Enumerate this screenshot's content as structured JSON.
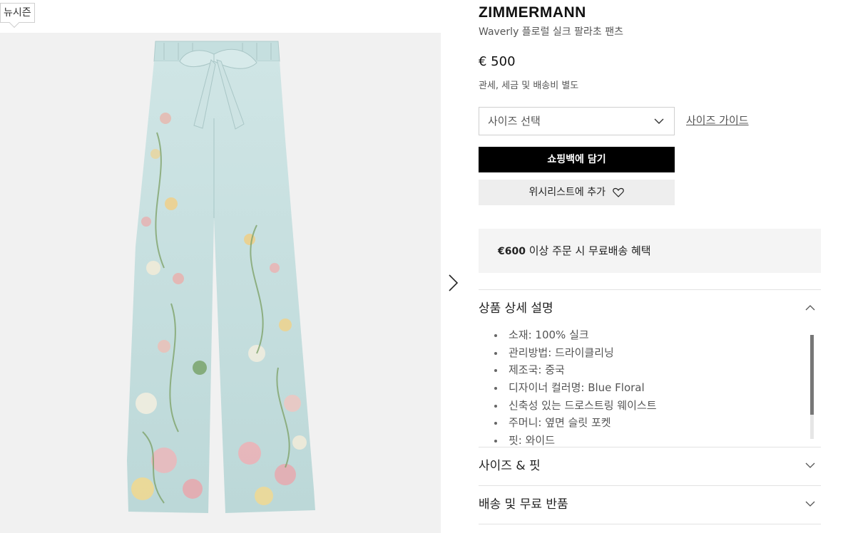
{
  "badge": {
    "label": "뉴시즌"
  },
  "product": {
    "brand": "ZIMMERMANN",
    "name": "Waverly 플로럴 실크 팔라초 팬츠",
    "price": "€ 500",
    "tax_note": "관세, 세금 및 배송비 별도"
  },
  "actions": {
    "size_select_placeholder": "사이즈 선택",
    "size_guide": "사이즈 가이드",
    "add_to_bag": "쇼핑백에 담기",
    "add_to_wishlist": "위시리스트에 추가"
  },
  "promo": {
    "amount": "€600",
    "text": " 이상 주문 시 무료배송 혜택"
  },
  "accordion": {
    "details_title": "상품 상세 설명",
    "details_items": [
      "소재: 100% 실크",
      "관리방법: 드라이클리닝",
      "제조국: 중국",
      "디자이너 컬러명: Blue Floral",
      "신축성 있는 드로스트링 웨이스트",
      "주머니: 옆면 슬릿 포켓",
      "핏: 와이드"
    ],
    "size_fit_title": "사이즈 & 핏",
    "shipping_title": "배송 및 무료 반품"
  },
  "colors": {
    "fabric": "#c9e1e1",
    "button_black": "#000000",
    "gallery_bg": "#f1f1f1"
  },
  "icons": {
    "size_chevron": "chevron-down-icon",
    "wishlist_heart": "heart-icon",
    "next_image": "chevron-right-icon",
    "accordion_open": "chevron-up-icon",
    "accordion_closed": "chevron-down-icon"
  }
}
